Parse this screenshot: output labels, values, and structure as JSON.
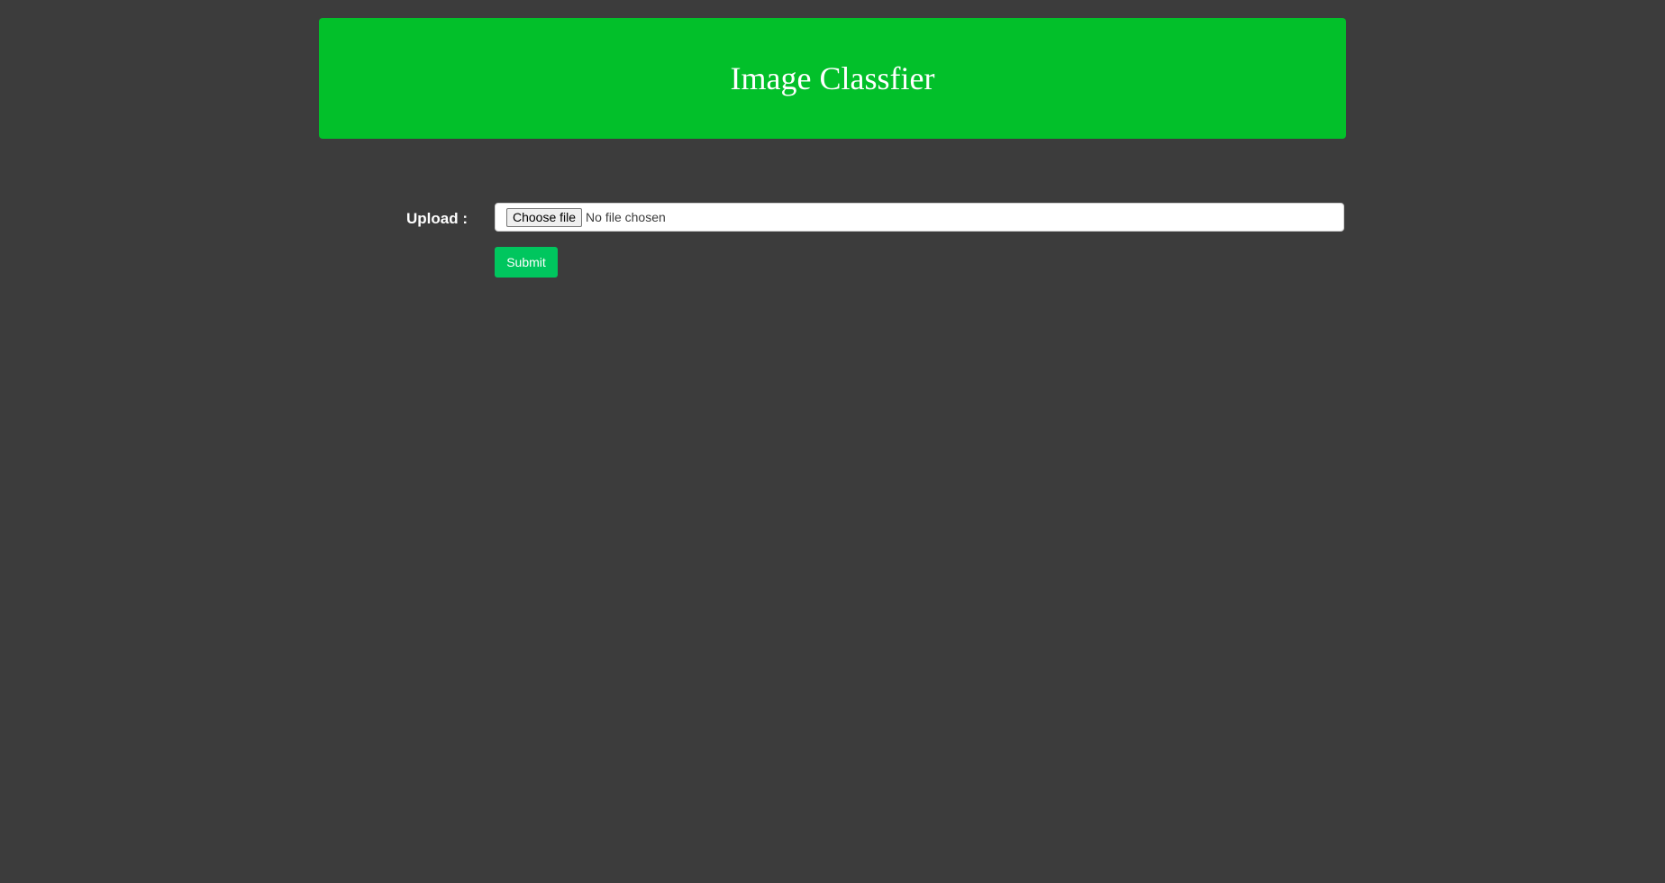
{
  "header": {
    "title": "Image Classfier"
  },
  "form": {
    "upload_label": "Upload :",
    "file_input": {
      "button_label": "Choose file",
      "status_text": "No file chosen"
    },
    "submit_label": "Submit"
  },
  "colors": {
    "background": "#3c3c3c",
    "header_bg": "#02c02a",
    "submit_bg": "#00c65e"
  }
}
